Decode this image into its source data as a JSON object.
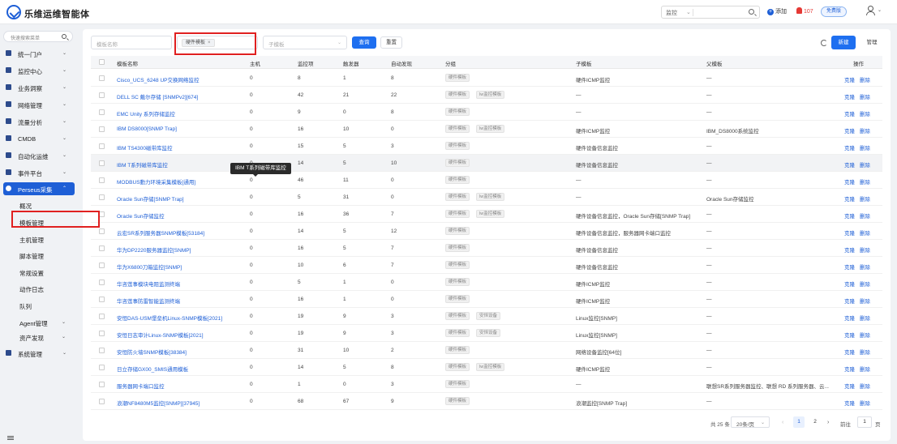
{
  "app": {
    "title": "乐维运维智能体"
  },
  "topbar": {
    "monitor_select": "监控",
    "add_label": "添加",
    "alarm_count": "107",
    "free_label": "免费版"
  },
  "sidebar": {
    "search_placeholder": "快速搜索菜单",
    "items": [
      {
        "label": "统一门户"
      },
      {
        "label": "监控中心"
      },
      {
        "label": "业务洞察"
      },
      {
        "label": "网络管理"
      },
      {
        "label": "流量分析"
      },
      {
        "label": "CMDB"
      },
      {
        "label": "自动化运维"
      },
      {
        "label": "事件平台"
      },
      {
        "label": "Perseus采集"
      },
      {
        "label": "系统管理"
      }
    ],
    "subitems": [
      {
        "label": "概况"
      },
      {
        "label": "模板管理"
      },
      {
        "label": "主机管理"
      },
      {
        "label": "脚本管理"
      },
      {
        "label": "常规设置"
      },
      {
        "label": "动作日志"
      },
      {
        "label": "队列"
      },
      {
        "label": "Agent管理"
      },
      {
        "label": "资产发现"
      }
    ]
  },
  "filters": {
    "name_placeholder": "模板名称",
    "tag_value": "硬件模板",
    "sub_placeholder": "子模板",
    "query_label": "查询",
    "reset_label": "重置",
    "new_label": "新建",
    "manage_label": "管理"
  },
  "table": {
    "headers": [
      "模板名称",
      "主机",
      "监控项",
      "触发器",
      "自动发现",
      "分组",
      "子模板",
      "父模板",
      "操作"
    ],
    "ops": {
      "edit": "克隆",
      "delete": "删除"
    },
    "rows": [
      {
        "name": "Cisco_UCS_6248 UP交换网络监控",
        "host": "0",
        "items": "8",
        "triggers": "1",
        "disc": "8",
        "groups": [
          "硬件模板"
        ],
        "child": "硬件ICMP监控",
        "parent": "—"
      },
      {
        "name": "DELL SC 戴尔存储 [SNMPv2][674]",
        "host": "0",
        "items": "42",
        "triggers": "21",
        "disc": "22",
        "groups": [
          "硬件模板",
          "lw监控模板"
        ],
        "child": "—",
        "parent": "—"
      },
      {
        "name": "EMC Unity 系列存储监控",
        "host": "0",
        "items": "9",
        "triggers": "0",
        "disc": "8",
        "groups": [
          "硬件模板"
        ],
        "child": "—",
        "parent": "—"
      },
      {
        "name": "IBM DS8000[SNMP Trap]",
        "host": "0",
        "items": "16",
        "triggers": "10",
        "disc": "0",
        "groups": [
          "硬件模板",
          "lw监控模板"
        ],
        "child": "硬件ICMP监控",
        "parent": "IBM_DS8000系统监控"
      },
      {
        "name": "IBM TS4300磁带库监控",
        "host": "0",
        "items": "15",
        "triggers": "5",
        "disc": "3",
        "groups": [
          "硬件模板"
        ],
        "child": "硬件设备信息监控",
        "parent": "—"
      },
      {
        "name": "IBM T系列磁带库监控",
        "host": "0",
        "items": "14",
        "triggers": "5",
        "disc": "10",
        "groups": [
          "硬件模板"
        ],
        "child": "硬件设备信息监控",
        "parent": "—"
      },
      {
        "name": "MODBUS動力环境采集模板[通用]",
        "host": "0",
        "items": "46",
        "triggers": "11",
        "disc": "0",
        "groups": [
          "硬件模板"
        ],
        "child": "—",
        "parent": "—"
      },
      {
        "name": "Oracle Sun存储[SNMP Trap]",
        "host": "0",
        "items": "5",
        "triggers": "31",
        "disc": "0",
        "groups": [
          "硬件模板",
          "lw监控模板"
        ],
        "child": "—",
        "parent": "Oracle Sun存储监控"
      },
      {
        "name": "Oracle Sun存储监控",
        "host": "0",
        "items": "16",
        "triggers": "36",
        "disc": "7",
        "groups": [
          "硬件模板",
          "lw监控模板"
        ],
        "child": "硬件设备信息监控，Oracle Sun存储[SNMP Trap]",
        "parent": "—"
      },
      {
        "name": "云宏SR系列服务器SNMP模板[53184]",
        "host": "0",
        "items": "14",
        "triggers": "5",
        "disc": "12",
        "groups": [
          "硬件模板"
        ],
        "child": "硬件设备信息监控，服务器网卡端口监控",
        "parent": "—"
      },
      {
        "name": "华为DP2220服务器监控[SNMP]",
        "host": "0",
        "items": "16",
        "triggers": "5",
        "disc": "7",
        "groups": [
          "硬件模板"
        ],
        "child": "硬件设备信息监控",
        "parent": "—"
      },
      {
        "name": "华为X6800刀箱监控[SNMP]",
        "host": "0",
        "items": "10",
        "triggers": "6",
        "disc": "7",
        "groups": [
          "硬件模板"
        ],
        "child": "硬件设备信息监控",
        "parent": "—"
      },
      {
        "name": "华咨莲事模块电阻监测终端",
        "host": "0",
        "items": "5",
        "triggers": "1",
        "disc": "0",
        "groups": [
          "硬件模板"
        ],
        "child": "硬件ICMP监控",
        "parent": "—"
      },
      {
        "name": "华咨莲事防雷智能监测终端",
        "host": "0",
        "items": "16",
        "triggers": "1",
        "disc": "0",
        "groups": [
          "硬件模板"
        ],
        "child": "硬件ICMP监控",
        "parent": "—"
      },
      {
        "name": "安恒DAS-USM堡垒机Linux-SNMP模板[2021]",
        "host": "0",
        "items": "19",
        "triggers": "9",
        "disc": "3",
        "groups": [
          "硬件模板",
          "安恒设备"
        ],
        "child": "Linux监控[SNMP]",
        "parent": "—"
      },
      {
        "name": "安恒日志审计Linux-SNMP模板[2021]",
        "host": "0",
        "items": "19",
        "triggers": "9",
        "disc": "3",
        "groups": [
          "硬件模板",
          "安恒设备"
        ],
        "child": "Linux监控[SNMP]",
        "parent": "—"
      },
      {
        "name": "安恒防火墙SNMP模板[38384]",
        "host": "0",
        "items": "31",
        "triggers": "10",
        "disc": "2",
        "groups": [
          "硬件模板"
        ],
        "child": "网络设备监控[64位]",
        "parent": "—"
      },
      {
        "name": "日立存储GX00_SMIS通用模板",
        "host": "0",
        "items": "14",
        "triggers": "5",
        "disc": "8",
        "groups": [
          "硬件模板",
          "lw监控模板"
        ],
        "child": "硬件ICMP监控",
        "parent": "—"
      },
      {
        "name": "服务器网卡端口监控",
        "host": "0",
        "items": "1",
        "triggers": "0",
        "disc": "3",
        "groups": [
          "硬件模板"
        ],
        "child": "—",
        "parent": "联想SR系列服务器监控、联想 RD 系列服务器、云..."
      },
      {
        "name": "浪潮NF8480M5监控[SNMP][37945]",
        "host": "0",
        "items": "68",
        "triggers": "67",
        "disc": "9",
        "groups": [
          "硬件模板"
        ],
        "child": "浪潮监控[SNMP Trap]",
        "parent": "—"
      }
    ]
  },
  "tooltip": {
    "text": "IBM T系列磁带库监控"
  },
  "pagination": {
    "total": "共 25 条",
    "page_size": "20条/页",
    "pages": [
      "1",
      "2"
    ],
    "goto_label": "前往",
    "goto_value": "1",
    "unit": "页"
  }
}
